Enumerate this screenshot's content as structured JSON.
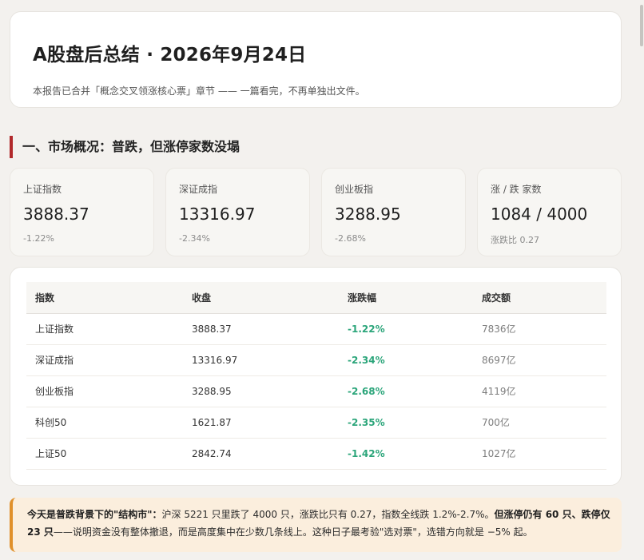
{
  "header": {
    "title": "A股盘后总结 · 2026年9月24日",
    "subtitle": "本报告已合并「概念交叉领涨核心票」章节 —— 一篇看完，不再单独出文件。"
  },
  "section1": {
    "title": "一、市场概况：普跌，但涨停家数没塌"
  },
  "stats": [
    {
      "label": "上证指数",
      "value": "3888.37",
      "sub": "-1.22%"
    },
    {
      "label": "深证成指",
      "value": "13316.97",
      "sub": "-2.34%"
    },
    {
      "label": "创业板指",
      "value": "3288.95",
      "sub": "-2.68%"
    },
    {
      "label": "涨 / 跌 家数",
      "value": "1084 / 4000",
      "sub": "涨跌比 0.27"
    }
  ],
  "table": {
    "headers": [
      "指数",
      "收盘",
      "涨跌幅",
      "成交额"
    ],
    "rows": [
      [
        "上证指数",
        "3888.37",
        "-1.22%",
        "7836亿"
      ],
      [
        "深证成指",
        "13316.97",
        "-2.34%",
        "8697亿"
      ],
      [
        "创业板指",
        "3288.95",
        "-2.68%",
        "4119亿"
      ],
      [
        "科创50",
        "1621.87",
        "-2.35%",
        "700亿"
      ],
      [
        "上证50",
        "2842.74",
        "-1.42%",
        "1027亿"
      ]
    ]
  },
  "note": {
    "lead": "今天是普跌背景下的\"结构市\"：",
    "part1": "沪深 5221 只里跌了 4000 只，涨跌比只有 0.27，指数全线跌 1.2%-2.7%。",
    "bold2": "但涨停仍有 60 只、跌停仅 23 只",
    "part2": "——说明资金没有整体撤退，而是高度集中在少数几条线上。这种日子最考验\"选对票\"，选错方向就是 −5% 起。"
  },
  "colors": {
    "accent_red": "#b1292b",
    "up_green": "#2ba57a",
    "note_bg": "#fbeedd",
    "note_border": "#e0902a"
  }
}
